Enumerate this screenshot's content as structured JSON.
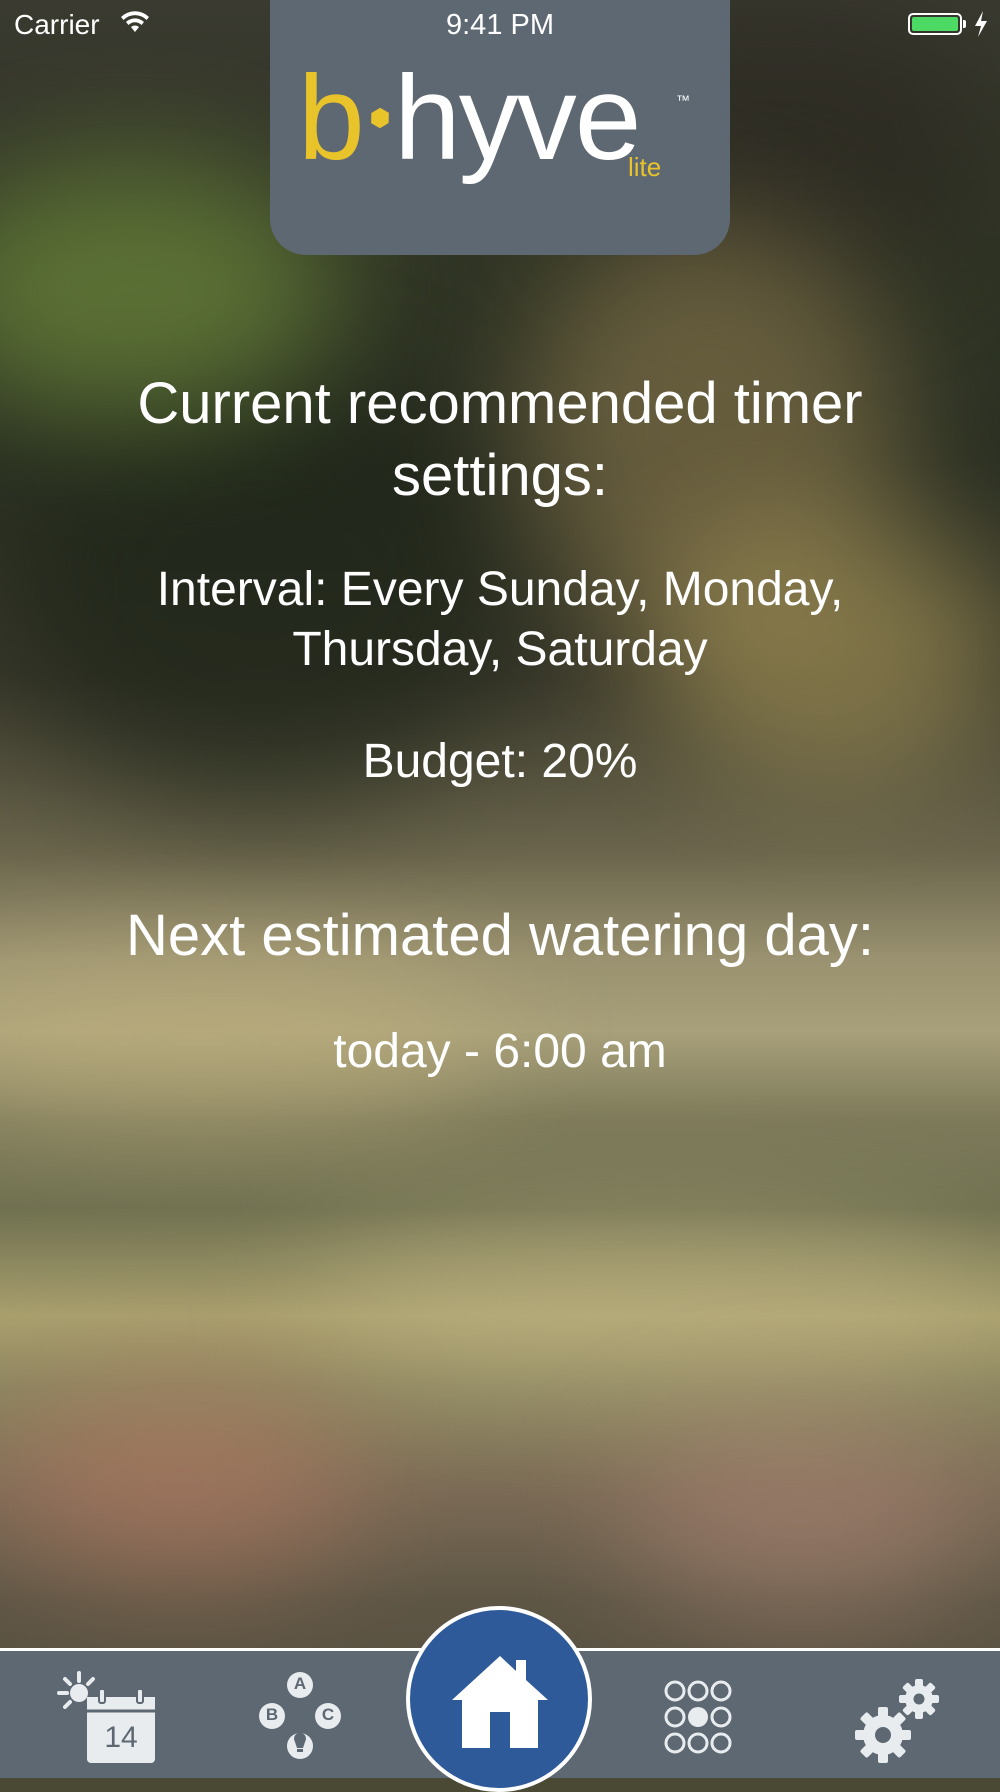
{
  "status_bar": {
    "carrier": "Carrier",
    "time": "9:41 PM",
    "battery_color": "#4cd964"
  },
  "logo": {
    "brand_b": "b",
    "brand_rest": "hyve",
    "variant": "lite",
    "trademark": "™",
    "accent_color": "#e9c32a"
  },
  "main": {
    "recommended_heading": "Current recommended timer settings:",
    "interval_text": "Interval: Every Sunday, Monday, Thursday, Saturday",
    "budget_text": "Budget: 20%",
    "next_heading": "Next estimated watering day:",
    "next_time": "today - 6:00 am"
  },
  "tab_bar": {
    "background": "#5d6872",
    "home_color": "#2e5a99",
    "items": [
      {
        "name": "schedule",
        "icon": "calendar-weather-icon",
        "calendar_day": "14"
      },
      {
        "name": "programs",
        "icon": "abc-programs-icon",
        "letters": [
          "A",
          "B",
          "C"
        ]
      },
      {
        "name": "home",
        "icon": "home-icon"
      },
      {
        "name": "zones",
        "icon": "zones-grid-icon"
      },
      {
        "name": "settings",
        "icon": "gears-icon"
      }
    ]
  }
}
